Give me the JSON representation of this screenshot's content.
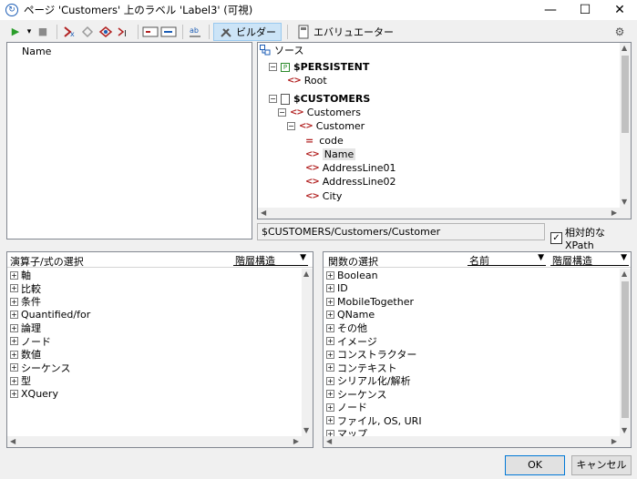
{
  "window": {
    "title": "ページ 'Customers' 上のラベル 'Label3' (可視)",
    "minimize": "—",
    "maximize": "☐",
    "close": "✕"
  },
  "toolbar": {
    "run": "▶",
    "run_dropdown": "▾",
    "stop": "■",
    "builder_label": "ビルダー",
    "evaluator_label": "エバリュエーター",
    "settings": "⚙"
  },
  "editor": {
    "expression": "Name"
  },
  "source": {
    "header": "ソース",
    "nodes": [
      {
        "label": "$PERSISTENT",
        "bold": true
      },
      {
        "label": "Root"
      },
      {
        "label": "$CUSTOMERS",
        "bold": true
      },
      {
        "label": "Customers"
      },
      {
        "label": "Customer"
      },
      {
        "label": "code"
      },
      {
        "label": "Name",
        "selected": true
      },
      {
        "label": "AddressLine01"
      },
      {
        "label": "AddressLine02"
      },
      {
        "label": "City"
      }
    ],
    "path": "$CUSTOMERS/Customers/Customer",
    "relative_label": "相対的な XPath",
    "relative_checked": true
  },
  "operators": {
    "title": "演算子/式の選択",
    "mode": "階層構造",
    "items": [
      "軸",
      "比較",
      "条件",
      "Quantified/for",
      "論理",
      "ノード",
      "数値",
      "シーケンス",
      "型",
      "XQuery"
    ]
  },
  "functions": {
    "title": "関数の選択",
    "sort": "名前",
    "mode": "階層構造",
    "items": [
      "Boolean",
      "ID",
      "MobileTogether",
      "QName",
      "その他",
      "イメージ",
      "コンストラクター",
      "コンテキスト",
      "シリアル化/解析",
      "シーケンス",
      "ノード",
      "ファイル, OS, URI",
      "マップ"
    ]
  },
  "buttons": {
    "ok": "OK",
    "cancel": "キャンセル"
  },
  "colors": {
    "accent": "#cce4f7",
    "tag": "#b22222",
    "run": "#2a9d2a"
  }
}
